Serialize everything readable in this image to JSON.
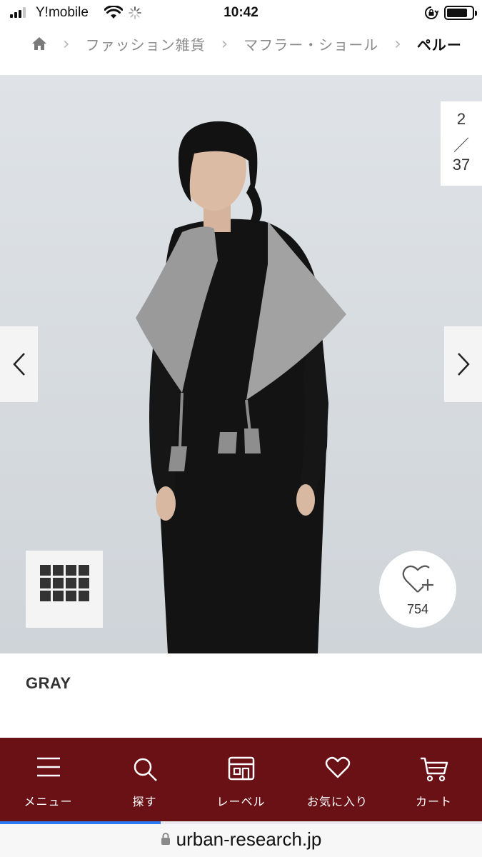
{
  "status_bar": {
    "carrier": "Y!mobile",
    "time": "10:42"
  },
  "breadcrumb": {
    "items": [
      "ファッション雑貨",
      "マフラー・ショール"
    ],
    "current": "ペルー"
  },
  "gallery": {
    "current_index": "2",
    "separator": "／",
    "total": "37",
    "favorite_count": "754"
  },
  "product": {
    "color": "GRAY"
  },
  "bottom_nav": {
    "tabs": [
      {
        "label": "メニュー",
        "icon": "menu-icon"
      },
      {
        "label": "探す",
        "icon": "search-icon"
      },
      {
        "label": "レーベル",
        "icon": "store-icon"
      },
      {
        "label": "お気に入り",
        "icon": "heart-icon"
      },
      {
        "label": "カート",
        "icon": "cart-icon"
      }
    ]
  },
  "browser": {
    "url": "urban-research.jp"
  },
  "colors": {
    "nav_background": "#6a1116",
    "gallery_background": "#d8dde2",
    "progress": "#2b7cf4"
  }
}
